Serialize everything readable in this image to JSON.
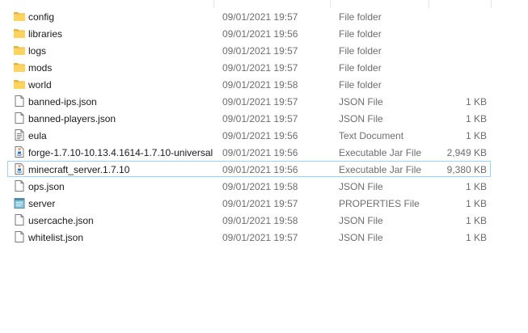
{
  "files": [
    {
      "name": "config",
      "date": "09/01/2021 19:57",
      "type": "File folder",
      "size": "",
      "icon": "folder-icon"
    },
    {
      "name": "libraries",
      "date": "09/01/2021 19:56",
      "type": "File folder",
      "size": "",
      "icon": "folder-icon"
    },
    {
      "name": "logs",
      "date": "09/01/2021 19:57",
      "type": "File folder",
      "size": "",
      "icon": "folder-icon"
    },
    {
      "name": "mods",
      "date": "09/01/2021 19:57",
      "type": "File folder",
      "size": "",
      "icon": "folder-icon"
    },
    {
      "name": "world",
      "date": "09/01/2021 19:58",
      "type": "File folder",
      "size": "",
      "icon": "folder-icon"
    },
    {
      "name": "banned-ips.json",
      "date": "09/01/2021 19:57",
      "type": "JSON File",
      "size": "1 KB",
      "icon": "document-icon"
    },
    {
      "name": "banned-players.json",
      "date": "09/01/2021 19:57",
      "type": "JSON File",
      "size": "1 KB",
      "icon": "document-icon"
    },
    {
      "name": "eula",
      "date": "09/01/2021 19:56",
      "type": "Text Document",
      "size": "1 KB",
      "icon": "text-document-icon"
    },
    {
      "name": "forge-1.7.10-10.13.4.1614-1.7.10-universal",
      "date": "09/01/2021 19:56",
      "type": "Executable Jar File",
      "size": "2,949 KB",
      "icon": "java-jar-icon"
    },
    {
      "name": "minecraft_server.1.7.10",
      "date": "09/01/2021 19:56",
      "type": "Executable Jar File",
      "size": "9,380 KB",
      "icon": "java-jar-icon",
      "selected": true
    },
    {
      "name": "ops.json",
      "date": "09/01/2021 19:58",
      "type": "JSON File",
      "size": "1 KB",
      "icon": "document-icon"
    },
    {
      "name": "server",
      "date": "09/01/2021 19:57",
      "type": "PROPERTIES File",
      "size": "1 KB",
      "icon": "properties-file-icon"
    },
    {
      "name": "usercache.json",
      "date": "09/01/2021 19:58",
      "type": "JSON File",
      "size": "1 KB",
      "icon": "document-icon"
    },
    {
      "name": "whitelist.json",
      "date": "09/01/2021 19:57",
      "type": "JSON File",
      "size": "1 KB",
      "icon": "document-icon"
    }
  ]
}
